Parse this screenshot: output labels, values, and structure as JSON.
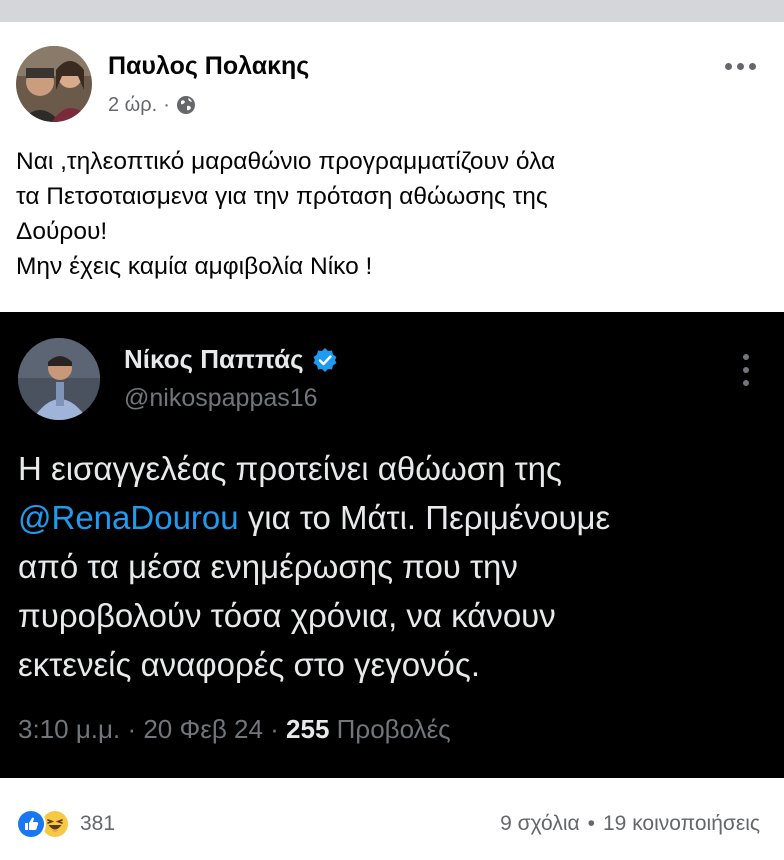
{
  "post": {
    "author": "Παυλος Πολακης",
    "time": "2 ώρ.",
    "separator": "·",
    "privacy_icon": "globe-icon",
    "text_lines": [
      "Ναι ,τηλεοπτικό μαραθώνιο προγραμματίζουν όλα",
      "τα Πετσοταισμενα για την πρόταση αθώωσης της",
      "Δούρου!",
      "Μην έχεις καμία αμφιβολία Νίκο !"
    ]
  },
  "tweet": {
    "name": "Νίκος Παππάς",
    "handle": "@nikospappas16",
    "verified_icon": "verified-badge-icon",
    "body": {
      "line1": "Η εισαγγελέας προτείνει αθώωση της",
      "mention": "@RenaDourou",
      "line2_rest": " για το Μάτι. Περιμένουμε",
      "line3": "από τα μέσα ενημέρωσης που την",
      "line4": "πυροβολούν τόσα χρόνια, να κάνουν",
      "line5": "εκτενείς αναφορές στο γεγονός."
    },
    "meta_prefix": "3:10 μ.μ. · 20 Φεβ 24 · ",
    "views_count": "255",
    "views_label": " Προβολές"
  },
  "footer": {
    "reaction_icons": [
      "like-icon",
      "haha-icon"
    ],
    "reaction_count": "381",
    "comments": "9 σχόλια",
    "dot": "•",
    "shares": "19 κοινοποιήσεις"
  },
  "colors": {
    "facebook_blue": "#1877f2",
    "twitter_blue": "#1d9bf0",
    "tweet_bg": "#000000",
    "secondary_text": "#65676b"
  }
}
